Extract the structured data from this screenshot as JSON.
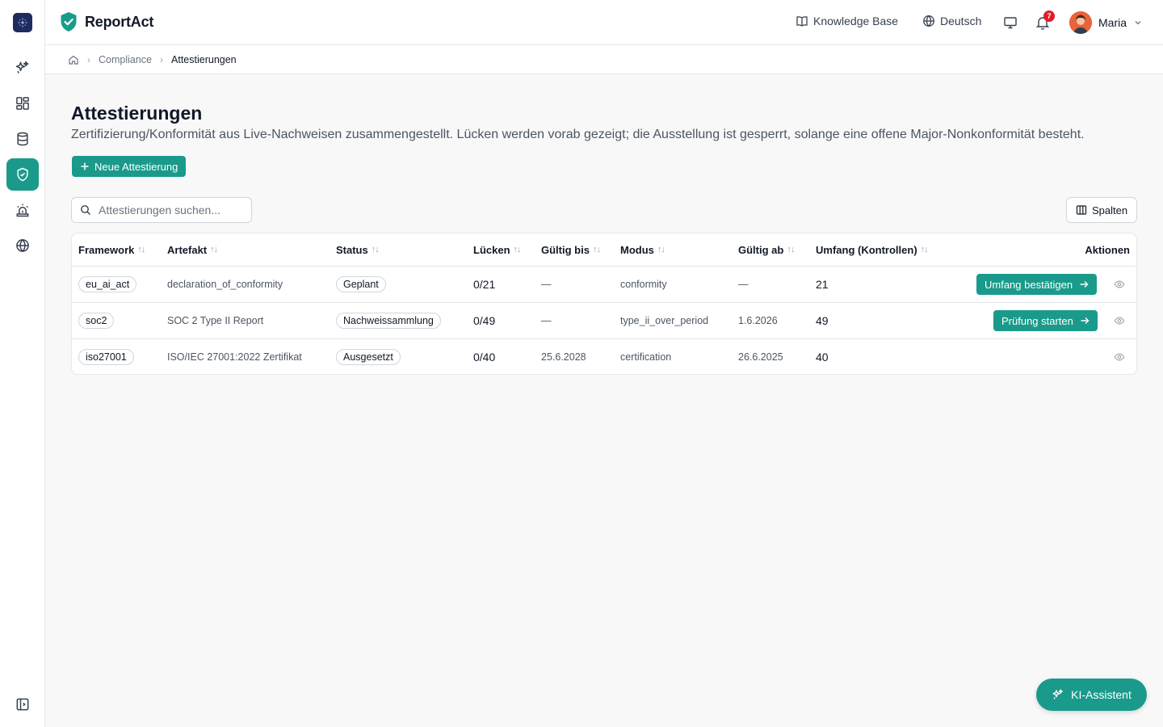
{
  "app": {
    "name": "ReportAct",
    "accent": "#1a9a8a"
  },
  "rail": {
    "items": [
      {
        "icon": "sparkles-icon"
      },
      {
        "icon": "dashboard-icon"
      },
      {
        "icon": "database-icon"
      },
      {
        "icon": "shield-check-icon",
        "active": true
      },
      {
        "icon": "siren-icon"
      },
      {
        "icon": "globe-icon"
      }
    ],
    "collapse_icon": "sidebar-toggle-icon"
  },
  "topbar": {
    "knowledge_base": "Knowledge Base",
    "language": "Deutsch",
    "notifications_count": "7",
    "user_name": "Maria"
  },
  "breadcrumb": {
    "items": [
      "Compliance",
      "Attestierungen"
    ]
  },
  "page": {
    "title": "Attestierungen",
    "description": "Zertifizierung/Konformität aus Live-Nachweisen zusammengestellt. Lücken werden vorab gezeigt; die Ausstellung ist gesperrt, solange eine offene Major-Nonkonformität besteht.",
    "new_button": "Neue Attestierung",
    "search_placeholder": "Attestierungen suchen...",
    "columns_button": "Spalten"
  },
  "table": {
    "headers": {
      "framework": "Framework",
      "artefakt": "Artefakt",
      "status": "Status",
      "luecken": "Lücken",
      "gueltig_bis": "Gültig bis",
      "modus": "Modus",
      "gueltig_ab": "Gültig ab",
      "umfang": "Umfang (Kontrollen)",
      "aktionen": "Aktionen"
    },
    "rows": [
      {
        "framework": "eu_ai_act",
        "artefakt": "declaration_of_conformity",
        "status": "Geplant",
        "luecken": "0/21",
        "gueltig_bis": "—",
        "modus": "conformity",
        "gueltig_ab": "—",
        "umfang": "21",
        "action": "Umfang bestätigen"
      },
      {
        "framework": "soc2",
        "artefakt": "SOC 2 Type II Report",
        "status": "Nachweissammlung",
        "luecken": "0/49",
        "gueltig_bis": "—",
        "modus": "type_ii_over_period",
        "gueltig_ab": "1.6.2026",
        "umfang": "49",
        "action": "Prüfung starten"
      },
      {
        "framework": "iso27001",
        "artefakt": "ISO/IEC 27001:2022 Zertifikat",
        "status": "Ausgesetzt",
        "luecken": "0/40",
        "gueltig_bis": "25.6.2028",
        "modus": "certification",
        "gueltig_ab": "26.6.2025",
        "umfang": "40",
        "action": ""
      }
    ]
  },
  "assistant": {
    "label": "KI-Assistent"
  }
}
